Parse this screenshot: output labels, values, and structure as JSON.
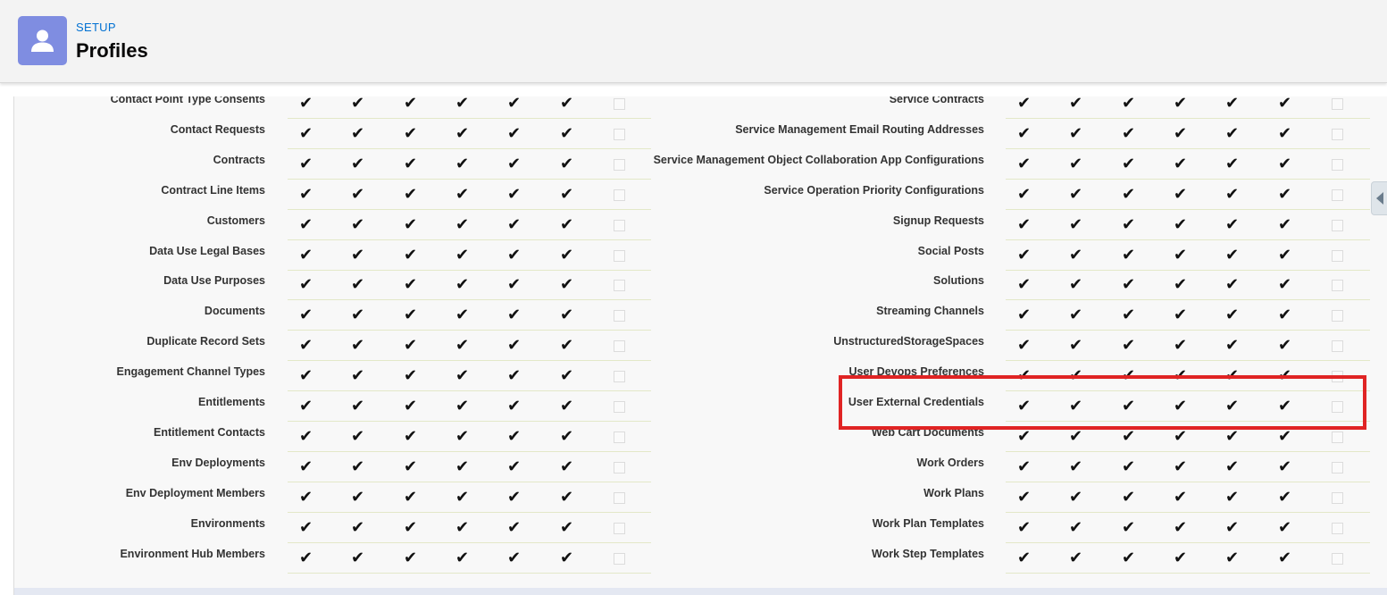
{
  "header": {
    "section": "SETUP",
    "title": "Profiles",
    "icon": "user-icon",
    "icon_color": "#7f8de1"
  },
  "check_glyph": "✔",
  "left_rows": [
    {
      "label": "Contact Point Type Consents",
      "checks": [
        true,
        true,
        true,
        true,
        true,
        true,
        false
      ]
    },
    {
      "label": "Contact Requests",
      "checks": [
        true,
        true,
        true,
        true,
        true,
        true,
        false
      ]
    },
    {
      "label": "Contracts",
      "checks": [
        true,
        true,
        true,
        true,
        true,
        true,
        false
      ]
    },
    {
      "label": "Contract Line Items",
      "checks": [
        true,
        true,
        true,
        true,
        true,
        true,
        false
      ]
    },
    {
      "label": "Customers",
      "checks": [
        true,
        true,
        true,
        true,
        true,
        true,
        false
      ]
    },
    {
      "label": "Data Use Legal Bases",
      "checks": [
        true,
        true,
        true,
        true,
        true,
        true,
        false
      ]
    },
    {
      "label": "Data Use Purposes",
      "checks": [
        true,
        true,
        true,
        true,
        true,
        true,
        false
      ]
    },
    {
      "label": "Documents",
      "checks": [
        true,
        true,
        true,
        true,
        true,
        true,
        false
      ]
    },
    {
      "label": "Duplicate Record Sets",
      "checks": [
        true,
        true,
        true,
        true,
        true,
        true,
        false
      ]
    },
    {
      "label": "Engagement Channel Types",
      "checks": [
        true,
        true,
        true,
        true,
        true,
        true,
        false
      ]
    },
    {
      "label": "Entitlements",
      "checks": [
        true,
        true,
        true,
        true,
        true,
        true,
        false
      ]
    },
    {
      "label": "Entitlement Contacts",
      "checks": [
        true,
        true,
        true,
        true,
        true,
        true,
        false
      ]
    },
    {
      "label": "Env Deployments",
      "checks": [
        true,
        true,
        true,
        true,
        true,
        true,
        false
      ]
    },
    {
      "label": "Env Deployment Members",
      "checks": [
        true,
        true,
        true,
        true,
        true,
        true,
        false
      ]
    },
    {
      "label": "Environments",
      "checks": [
        true,
        true,
        true,
        true,
        true,
        true,
        false
      ]
    },
    {
      "label": "Environment Hub Members",
      "checks": [
        true,
        true,
        true,
        true,
        true,
        true,
        false
      ]
    }
  ],
  "right_rows": [
    {
      "label": "Service Contracts",
      "checks": [
        true,
        true,
        true,
        true,
        true,
        true,
        false
      ]
    },
    {
      "label": "Service Management Email Routing Addresses",
      "checks": [
        true,
        true,
        true,
        true,
        true,
        true,
        false
      ]
    },
    {
      "label": "Service Management Object Collaboration App Configurations",
      "checks": [
        true,
        true,
        true,
        true,
        true,
        true,
        false
      ]
    },
    {
      "label": "Service Operation Priority Configurations",
      "checks": [
        true,
        true,
        true,
        true,
        true,
        true,
        false
      ]
    },
    {
      "label": "Signup Requests",
      "checks": [
        true,
        true,
        true,
        true,
        true,
        true,
        false
      ]
    },
    {
      "label": "Social Posts",
      "checks": [
        true,
        true,
        true,
        true,
        true,
        true,
        false
      ]
    },
    {
      "label": "Solutions",
      "checks": [
        true,
        true,
        true,
        true,
        true,
        true,
        false
      ]
    },
    {
      "label": "Streaming Channels",
      "checks": [
        true,
        true,
        true,
        true,
        true,
        true,
        false
      ]
    },
    {
      "label": "UnstructuredStorageSpaces",
      "checks": [
        true,
        true,
        true,
        true,
        true,
        true,
        false
      ]
    },
    {
      "label": "User Devops Preferences",
      "checks": [
        true,
        true,
        true,
        true,
        true,
        true,
        false
      ]
    },
    {
      "label": "User External Credentials",
      "checks": [
        true,
        true,
        true,
        true,
        true,
        true,
        false
      ]
    },
    {
      "label": "Web Cart Documents",
      "checks": [
        true,
        true,
        true,
        true,
        true,
        true,
        false
      ]
    },
    {
      "label": "Work Orders",
      "checks": [
        true,
        true,
        true,
        true,
        true,
        true,
        false
      ]
    },
    {
      "label": "Work Plans",
      "checks": [
        true,
        true,
        true,
        true,
        true,
        true,
        false
      ]
    },
    {
      "label": "Work Plan Templates",
      "checks": [
        true,
        true,
        true,
        true,
        true,
        true,
        false
      ]
    },
    {
      "label": "Work Step Templates",
      "checks": [
        true,
        true,
        true,
        true,
        true,
        true,
        false
      ]
    }
  ],
  "highlight_row": "User External Credentials",
  "highlight_color": "#e02424"
}
